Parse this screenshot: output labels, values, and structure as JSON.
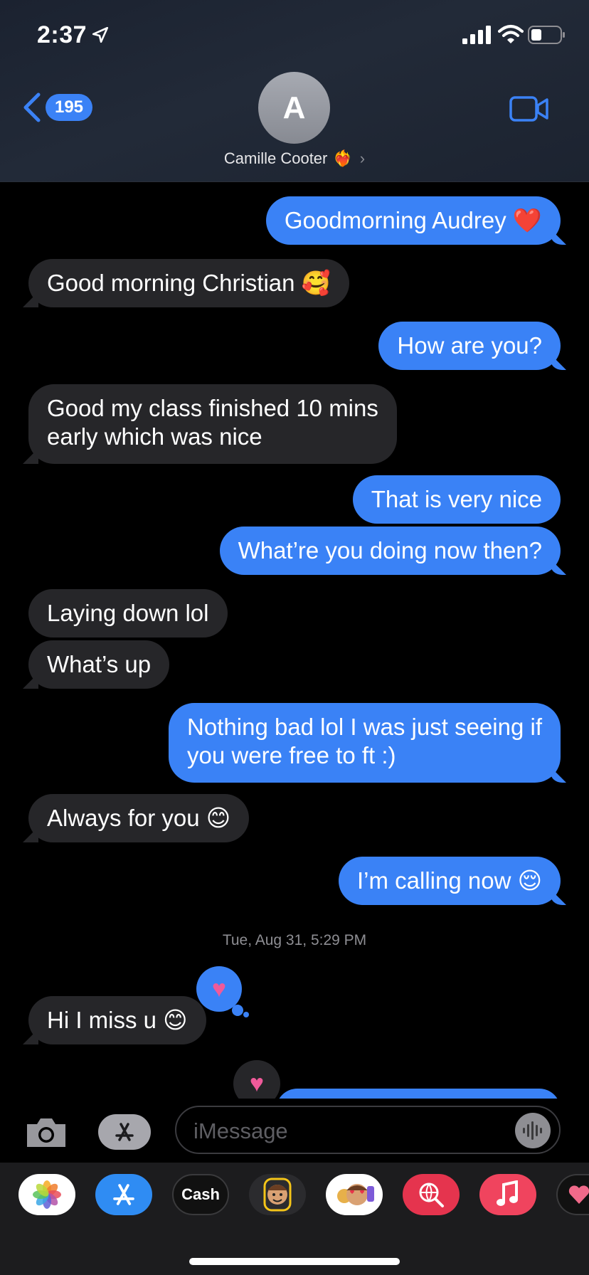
{
  "status": {
    "time": "2:37"
  },
  "header": {
    "back_count": "195",
    "avatar_letter": "A",
    "contact_name": "Camille Cooter",
    "contact_emoji": "❤️‍🔥",
    "chevron": "›"
  },
  "messages": [
    {
      "side": "sent",
      "text": "Goodmorning Audrey ❤️"
    },
    {
      "side": "recv",
      "text": "Good morning Christian 🥰"
    },
    {
      "side": "sent",
      "text": "How are you?"
    },
    {
      "side": "recv",
      "text": "Good my class finished 10 mins\nearly which was nice"
    },
    {
      "side": "sent",
      "text": "That is very nice"
    },
    {
      "side": "sent",
      "text": "What’re you doing now then?"
    },
    {
      "side": "recv",
      "text": "Laying down lol"
    },
    {
      "side": "recv",
      "text": "What’s up"
    },
    {
      "side": "sent",
      "text": "Nothing bad lol I was just seeing if\nyou were free to ft :)"
    },
    {
      "side": "recv",
      "text": "Always for you 😊"
    },
    {
      "side": "sent",
      "text": "I’m calling now 😌"
    },
    {
      "side": "recv",
      "text": "Hi I miss u 😊"
    }
  ],
  "timestamp": {
    "day": "Tue, Aug 31,",
    "time": "5:29 PM"
  },
  "tapbacks": {
    "heart": "♥"
  },
  "compose": {
    "placeholder": "iMessage"
  },
  "app_strip": {
    "cash_label": "Cash",
    "apple_glyph": ""
  },
  "colors": {
    "sent": "#3a82f6",
    "received": "#262629",
    "heart_pink": "#ef5a9a",
    "accent": "#3b82f6"
  }
}
